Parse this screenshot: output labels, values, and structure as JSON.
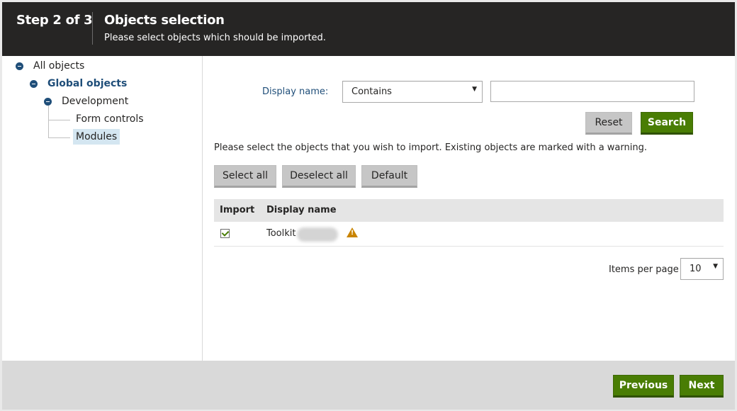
{
  "header": {
    "step": "Step 2 of 3",
    "title": "Objects selection",
    "subtitle": "Please select objects which should be imported."
  },
  "tree": {
    "all_objects": "All objects",
    "global_objects": "Global objects",
    "development": "Development",
    "form_controls": "Form controls",
    "modules": "Modules"
  },
  "filter": {
    "label": "Display name:",
    "operator": "Contains",
    "value": "",
    "reset_label": "Reset",
    "search_label": "Search"
  },
  "info": "Please select the objects that you wish to import. Existing objects are marked with a warning.",
  "actions": {
    "select_all": "Select all",
    "deselect_all": "Deselect all",
    "default": "Default"
  },
  "table": {
    "columns": [
      "Import",
      "Display name"
    ],
    "rows": [
      {
        "checked": true,
        "name": "Toolkit",
        "warning": true
      }
    ]
  },
  "pager": {
    "label": "Items per page",
    "value": "10"
  },
  "footer": {
    "previous_label": "Previous",
    "next_label": "Next"
  },
  "colors": {
    "header_bg": "#262524",
    "accent_green": "#497d04",
    "accent_blue": "#1f4e79",
    "warning": "#c98400"
  }
}
